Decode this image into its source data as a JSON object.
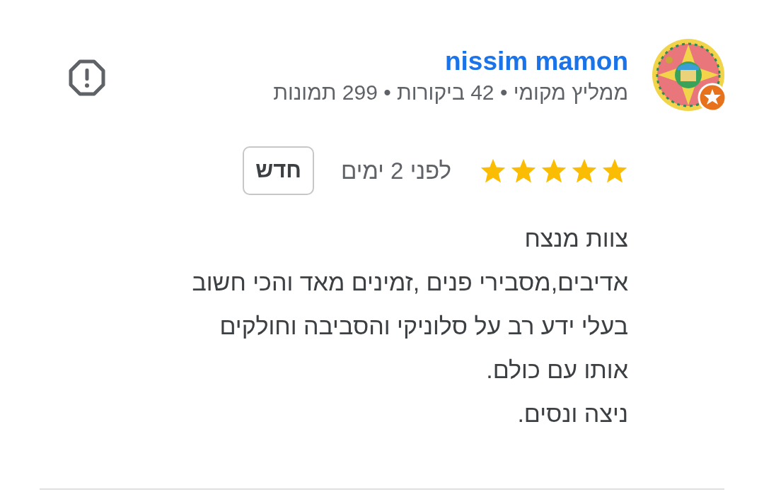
{
  "reviewer": {
    "name": "nissim mamon",
    "meta": "ממליץ מקומי • 42 ביקורות • 299 תמונות",
    "local_guide": true
  },
  "review": {
    "stars": 5,
    "time": "לפני 2 ימים",
    "badge": "חדש",
    "lines": [
      "צוות מנצח",
      "אדיבים,מסבירי פנים ,זמינים מאד והכי חשוב",
      "בעלי ידע רב על סלוניקי והסביבה וחולקים",
      "אותו עם כולם.",
      "ניצה ונסים."
    ]
  }
}
